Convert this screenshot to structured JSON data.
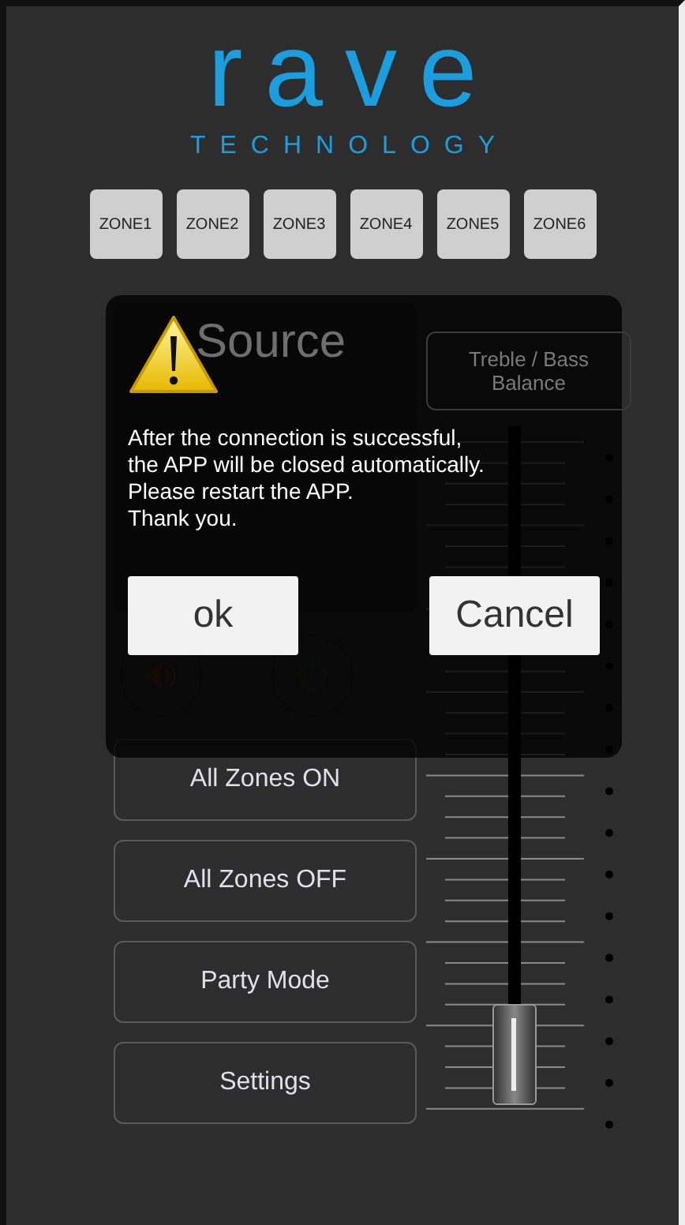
{
  "logo": {
    "wordmark": "rave",
    "tagline": "TECHNOLOGY"
  },
  "zones": [
    {
      "label": "ZONE1"
    },
    {
      "label": "ZONE2"
    },
    {
      "label": "ZONE3"
    },
    {
      "label": "ZONE4"
    },
    {
      "label": "ZONE5"
    },
    {
      "label": "ZONE6"
    }
  ],
  "source": {
    "title": "Source"
  },
  "tone_button": "Treble / Bass Balance",
  "actions": [
    "All Zones ON",
    "All Zones OFF",
    "Party Mode",
    "Settings"
  ],
  "volume": {
    "level": 0
  },
  "dialog": {
    "message": "After the connection is successful,\nthe APP will be closed automatically.\nPlease restart the APP.\nThank you.",
    "buttons": [
      "ok",
      "Cancel"
    ]
  }
}
